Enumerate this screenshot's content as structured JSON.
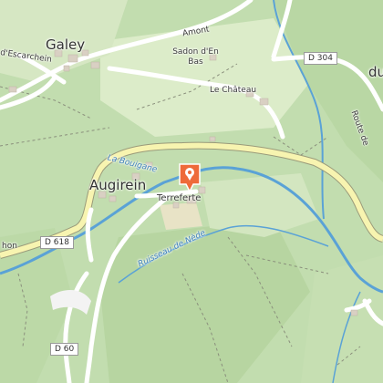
{
  "map": {
    "places": {
      "galey": "Galey",
      "augirein": "Augirein",
      "terreferte": "Terreferte",
      "sadon": "Sadon d'En Bas",
      "amont": "Amont",
      "le_chateau": "Le Château",
      "escarchein": "d'Escarchein",
      "du": "du",
      "route_de": "Route de",
      "hon": "hon"
    },
    "roads": {
      "d304": "D 304",
      "d618": "D 618",
      "d60": "D 60"
    },
    "waterways": {
      "la_bouigane": "La Bouigane",
      "ruisseau_nede": "Ruisseau de Nède"
    },
    "marker_icon": "location-pin-icon",
    "colors": {
      "forest": "#b8d6a3",
      "meadow": "#d5e8c5",
      "river": "#5aa2d6",
      "main_road": "#f7f4b0",
      "marker": "#ee6a3a"
    }
  }
}
